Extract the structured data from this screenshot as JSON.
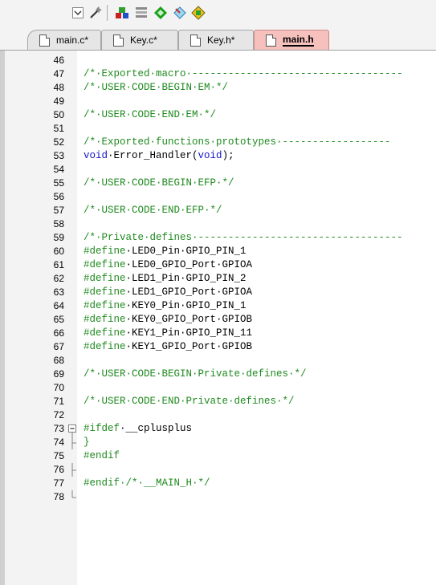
{
  "toolbar": {
    "buttons": [
      {
        "name": "dropdown-icon"
      },
      {
        "name": "wizard-icon"
      },
      {
        "name": "build-icon"
      },
      {
        "name": "layout-icon"
      },
      {
        "name": "diamond-icon"
      },
      {
        "name": "diamond-outline-icon"
      },
      {
        "name": "manage-icon"
      }
    ]
  },
  "tabs": [
    {
      "label": "main.c*",
      "active": false
    },
    {
      "label": "Key.c*",
      "active": false
    },
    {
      "label": "Key.h*",
      "active": false
    },
    {
      "label": "main.h",
      "active": true
    }
  ],
  "editor": {
    "lines": [
      {
        "n": "46",
        "code": []
      },
      {
        "n": "47",
        "code": [
          {
            "t": "/*·Exported·macro·-----------------------------------",
            "c": "c-comment"
          }
        ]
      },
      {
        "n": "48",
        "code": [
          {
            "t": "/*·USER·CODE·BEGIN·EM·*/",
            "c": "c-comment"
          }
        ]
      },
      {
        "n": "49",
        "code": []
      },
      {
        "n": "50",
        "code": [
          {
            "t": "/*·USER·CODE·END·EM·*/",
            "c": "c-comment"
          }
        ]
      },
      {
        "n": "51",
        "code": []
      },
      {
        "n": "52",
        "code": [
          {
            "t": "/*·Exported·functions·prototypes·------------------",
            "c": "c-comment"
          }
        ]
      },
      {
        "n": "53",
        "code": [
          {
            "t": "void",
            "c": "c-kw"
          },
          {
            "t": "·Error_Handler(",
            "c": ""
          },
          {
            "t": "void",
            "c": "c-kw"
          },
          {
            "t": ");",
            "c": ""
          }
        ]
      },
      {
        "n": "54",
        "code": []
      },
      {
        "n": "55",
        "code": [
          {
            "t": "/*·USER·CODE·BEGIN·EFP·*/",
            "c": "c-comment"
          }
        ]
      },
      {
        "n": "56",
        "code": []
      },
      {
        "n": "57",
        "code": [
          {
            "t": "/*·USER·CODE·END·EFP·*/",
            "c": "c-comment"
          }
        ]
      },
      {
        "n": "58",
        "code": []
      },
      {
        "n": "59",
        "code": [
          {
            "t": "/*·Private·defines·----------------------------------",
            "c": "c-comment"
          }
        ]
      },
      {
        "n": "60",
        "code": [
          {
            "t": "#define",
            "c": "c-pre"
          },
          {
            "t": "·LED0_Pin·GPIO_PIN_1",
            "c": ""
          }
        ]
      },
      {
        "n": "61",
        "code": [
          {
            "t": "#define",
            "c": "c-pre"
          },
          {
            "t": "·LED0_GPIO_Port·GPIOA",
            "c": ""
          }
        ]
      },
      {
        "n": "62",
        "code": [
          {
            "t": "#define",
            "c": "c-pre"
          },
          {
            "t": "·LED1_Pin·GPIO_PIN_2",
            "c": ""
          }
        ]
      },
      {
        "n": "63",
        "code": [
          {
            "t": "#define",
            "c": "c-pre"
          },
          {
            "t": "·LED1_GPIO_Port·GPIOA",
            "c": ""
          }
        ]
      },
      {
        "n": "64",
        "code": [
          {
            "t": "#define",
            "c": "c-pre"
          },
          {
            "t": "·KEY0_Pin·GPIO_PIN_1",
            "c": ""
          }
        ]
      },
      {
        "n": "65",
        "code": [
          {
            "t": "#define",
            "c": "c-pre"
          },
          {
            "t": "·KEY0_GPIO_Port·GPIOB",
            "c": ""
          }
        ]
      },
      {
        "n": "66",
        "code": [
          {
            "t": "#define",
            "c": "c-pre"
          },
          {
            "t": "·KEY1_Pin·GPIO_PIN_11",
            "c": ""
          }
        ]
      },
      {
        "n": "67",
        "code": [
          {
            "t": "#define",
            "c": "c-pre"
          },
          {
            "t": "·KEY1_GPIO_Port·GPIOB",
            "c": ""
          }
        ]
      },
      {
        "n": "68",
        "code": []
      },
      {
        "n": "69",
        "code": [
          {
            "t": "/*·USER·CODE·BEGIN·Private·defines·*/",
            "c": "c-comment"
          }
        ]
      },
      {
        "n": "70",
        "code": []
      },
      {
        "n": "71",
        "code": [
          {
            "t": "/*·USER·CODE·END·Private·defines·*/",
            "c": "c-comment"
          }
        ]
      },
      {
        "n": "72",
        "code": []
      },
      {
        "n": "73",
        "code": [
          {
            "t": "#ifdef",
            "c": "c-pre"
          },
          {
            "t": "·__cplusplus",
            "c": ""
          }
        ],
        "fold": "open"
      },
      {
        "n": "74",
        "code": [
          {
            "t": "}",
            "c": "c-comment"
          }
        ],
        "fold": "end"
      },
      {
        "n": "75",
        "code": [
          {
            "t": "#endif",
            "c": "c-pre"
          }
        ]
      },
      {
        "n": "76",
        "code": [],
        "fold": "end"
      },
      {
        "n": "77",
        "code": [
          {
            "t": "#endif",
            "c": "c-pre"
          },
          {
            "t": "·/*·__MAIN_H·*/",
            "c": "c-comment"
          }
        ]
      },
      {
        "n": "78",
        "code": [],
        "fold": "last"
      }
    ]
  }
}
